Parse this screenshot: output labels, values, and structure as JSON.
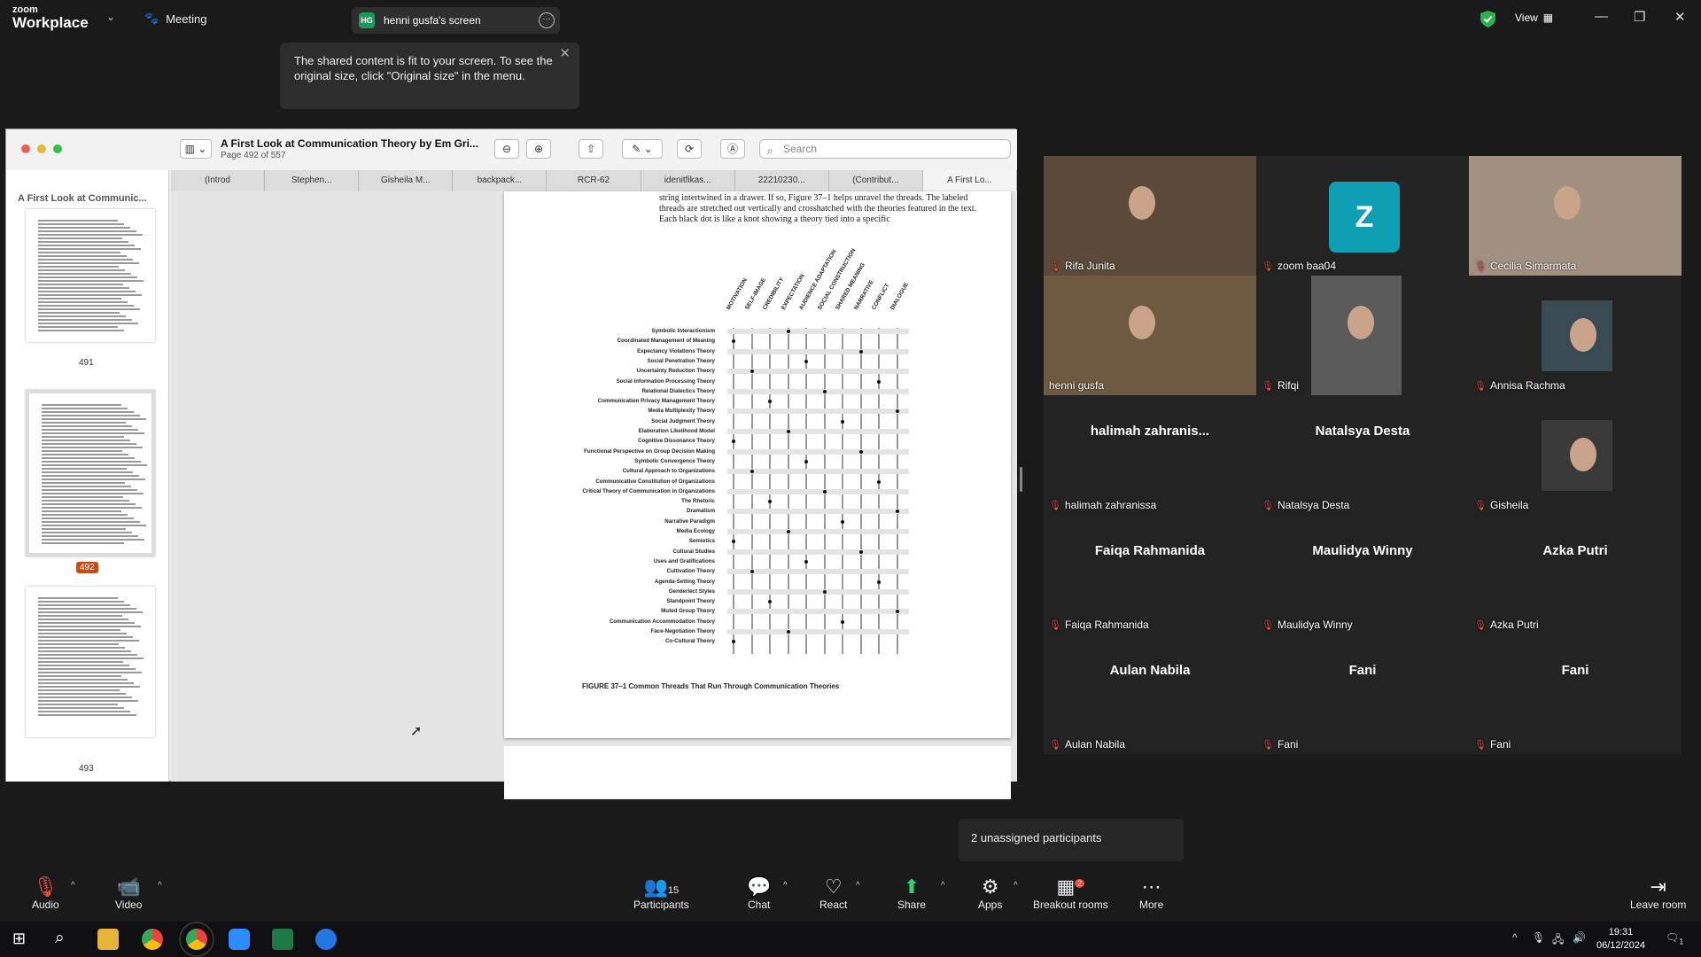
{
  "app": {
    "logo_line1": "zoom",
    "logo_line2": "Workplace",
    "meeting_label": "Meeting"
  },
  "screen_share": {
    "badge": "HG",
    "label": "henni gusfa's screen"
  },
  "view_label": "View",
  "tooltip": {
    "text": "The shared content is fit to your screen. To see the original size, click \"Original size\" in the menu."
  },
  "pdf": {
    "title": "A First Look at Communication Theory by Em Gri...",
    "subtitle": "Page 492 of 557",
    "search_placeholder": "Search",
    "tabs": [
      "(Introd",
      "Stephen...",
      "Gisheila M...",
      "backpack...",
      "RCR-62",
      "idenitfikas...",
      "22210230...",
      "(Contribut...",
      "A First Lo..."
    ],
    "sidebar_title": "A First Look at Communic...",
    "pages": [
      "491",
      "492",
      "493"
    ],
    "paragraph": "string intertwined in a drawer. If so, Figure 37–1 helps unravel the threads. The labeled threads are stretched out vertically and crosshatched with the theories featured in the text. Each black dot is like a knot showing a theory tied into a specific",
    "columns": [
      "MOTIVATION",
      "SELF-IMAGE",
      "CREDIBILITY",
      "EXPECTATION",
      "AUDIENCE ADAPTATION",
      "SOCIAL CONSTRUCTION",
      "SHARED MEANING",
      "NARRATIVE",
      "CONFLICT",
      "DIALOGUE"
    ],
    "theories": [
      "Symbolic Interactionism",
      "Coordinated Management of Meaning",
      "Expectancy Violations Theory",
      "Social Penetration Theory",
      "Uncertainty Reduction Theory",
      "Social Information Processing Theory",
      "Relational Dialectics Theory",
      "Communication Privacy Management Theory",
      "Media Multiplexity Theory",
      "Social Judgment Theory",
      "Elaboration Likelihood Model",
      "Cognitive Dissonance Theory",
      "Functional Perspective on Group Decision Making",
      "Symbolic Convergence Theory",
      "Cultural Approach to Organizations",
      "Communicative Constitution of Organizations",
      "Critical Theory of Communication in Organizations",
      "The Rhetoric",
      "Dramatism",
      "Narrative Paradigm",
      "Media Ecology",
      "Semiotics",
      "Cultural Studies",
      "Uses and Gratifications",
      "Cultivation Theory",
      "Agenda-Setting Theory",
      "Genderlect Styles",
      "Standpoint Theory",
      "Muted Group Theory",
      "Communication Accommodation Theory",
      "Face-Negotiation Theory",
      "Co-Cultural Theory"
    ],
    "caption": "FIGURE 37–1   Common Threads That Run Through Communication Theories"
  },
  "participants": [
    {
      "name": "Rifa Junita",
      "big": ""
    },
    {
      "name": "zoom baa04",
      "big": "Z"
    },
    {
      "name": "Cecilia Simarmata",
      "big": ""
    },
    {
      "name": "henni gusfa",
      "big": ""
    },
    {
      "name": "Rifqi",
      "big": ""
    },
    {
      "name": "Annisa Rachma",
      "big": ""
    },
    {
      "name": "halimah zahranissa",
      "big": "halimah  zahranis..."
    },
    {
      "name": "Natalsya Desta",
      "big": "Natalsya Desta"
    },
    {
      "name": "Gisheila",
      "big": ""
    },
    {
      "name": "Faiqa Rahmanida",
      "big": "Faiqa Rahmanida"
    },
    {
      "name": "Maulidya Winny",
      "big": "Maulidya Winny"
    },
    {
      "name": "Azka Putri",
      "big": "Azka Putri"
    },
    {
      "name": "Aulan Nabila",
      "big": "Aulan Nabila"
    },
    {
      "name": "Fani",
      "big": "Fani"
    },
    {
      "name": "Fani",
      "big": "Fani"
    }
  ],
  "unassigned": "2 unassigned participants",
  "toolbar": {
    "audio": "Audio",
    "video": "Video",
    "participants": "Participants",
    "participants_count": "15",
    "chat": "Chat",
    "react": "React",
    "share": "Share",
    "apps": "Apps",
    "breakout": "Breakout rooms",
    "breakout_badge": "2",
    "more": "More",
    "leave": "Leave room"
  },
  "taskbar": {
    "time": "19:31",
    "date": "06/12/2024",
    "notif": "1"
  }
}
